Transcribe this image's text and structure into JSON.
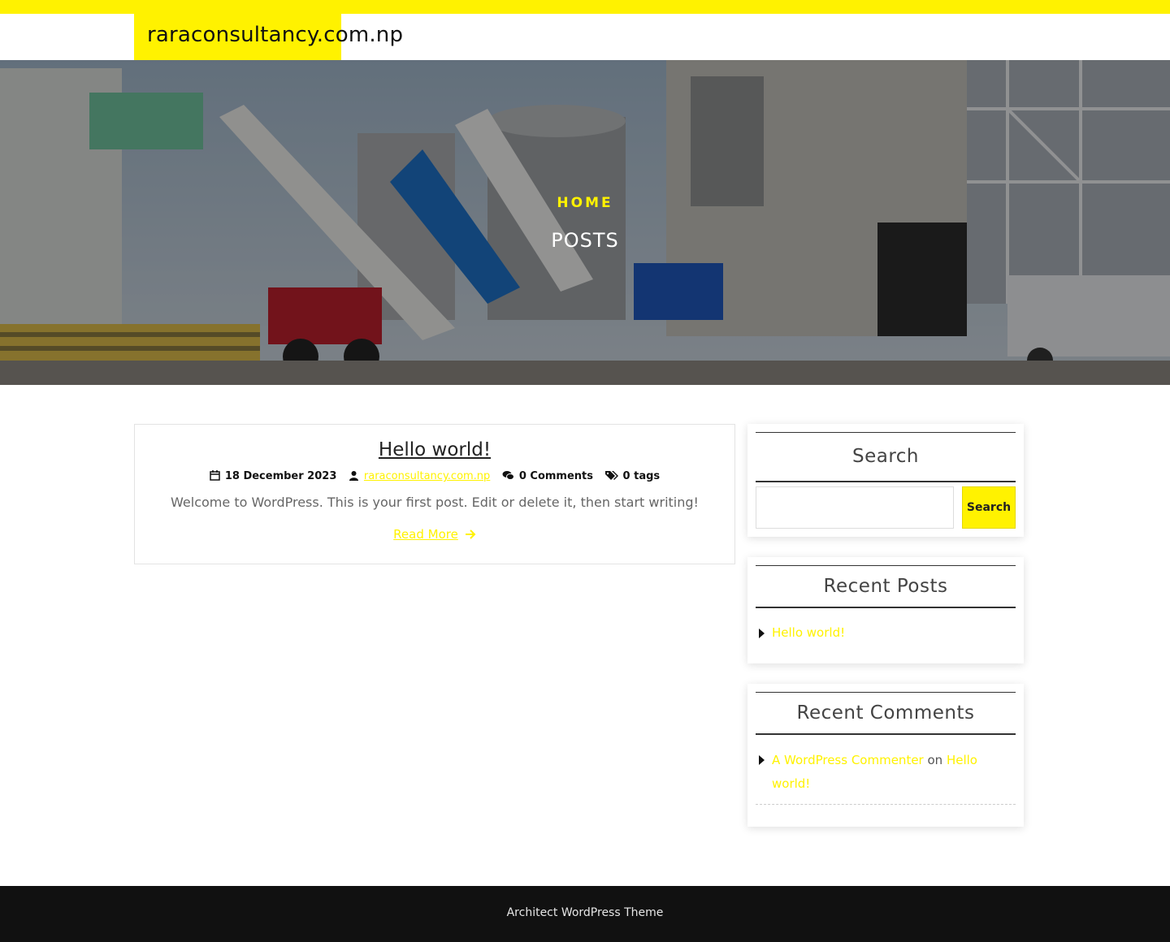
{
  "colors": {
    "accent": "#fff200",
    "dark": "#111111",
    "text_muted": "#666666"
  },
  "header": {
    "site_title": "raraconsultancy.com.np"
  },
  "hero": {
    "breadcrumb": "HOME",
    "title": "POSTS"
  },
  "post": {
    "title": "Hello world!",
    "date": "18 December 2023",
    "author": "raraconsultancy.com.np",
    "comments": "0 Comments",
    "tags": "0 tags",
    "excerpt": "Welcome to WordPress. This is your first post. Edit or delete it, then start writing!",
    "read_more": "Read More",
    "icons": [
      "calendar-icon",
      "user-icon",
      "comments-icon",
      "tags-icon",
      "arrow-right-icon"
    ]
  },
  "sidebar": {
    "search": {
      "title": "Search",
      "button": "Search",
      "value": ""
    },
    "recent_posts": {
      "title": "Recent Posts",
      "items": [
        "Hello world!"
      ]
    },
    "recent_comments": {
      "title": "Recent Comments",
      "items": [
        {
          "author": "A WordPress Commenter",
          "on": "on",
          "post": "Hello world!"
        }
      ]
    }
  },
  "footer": {
    "text": "Architect WordPress Theme"
  }
}
